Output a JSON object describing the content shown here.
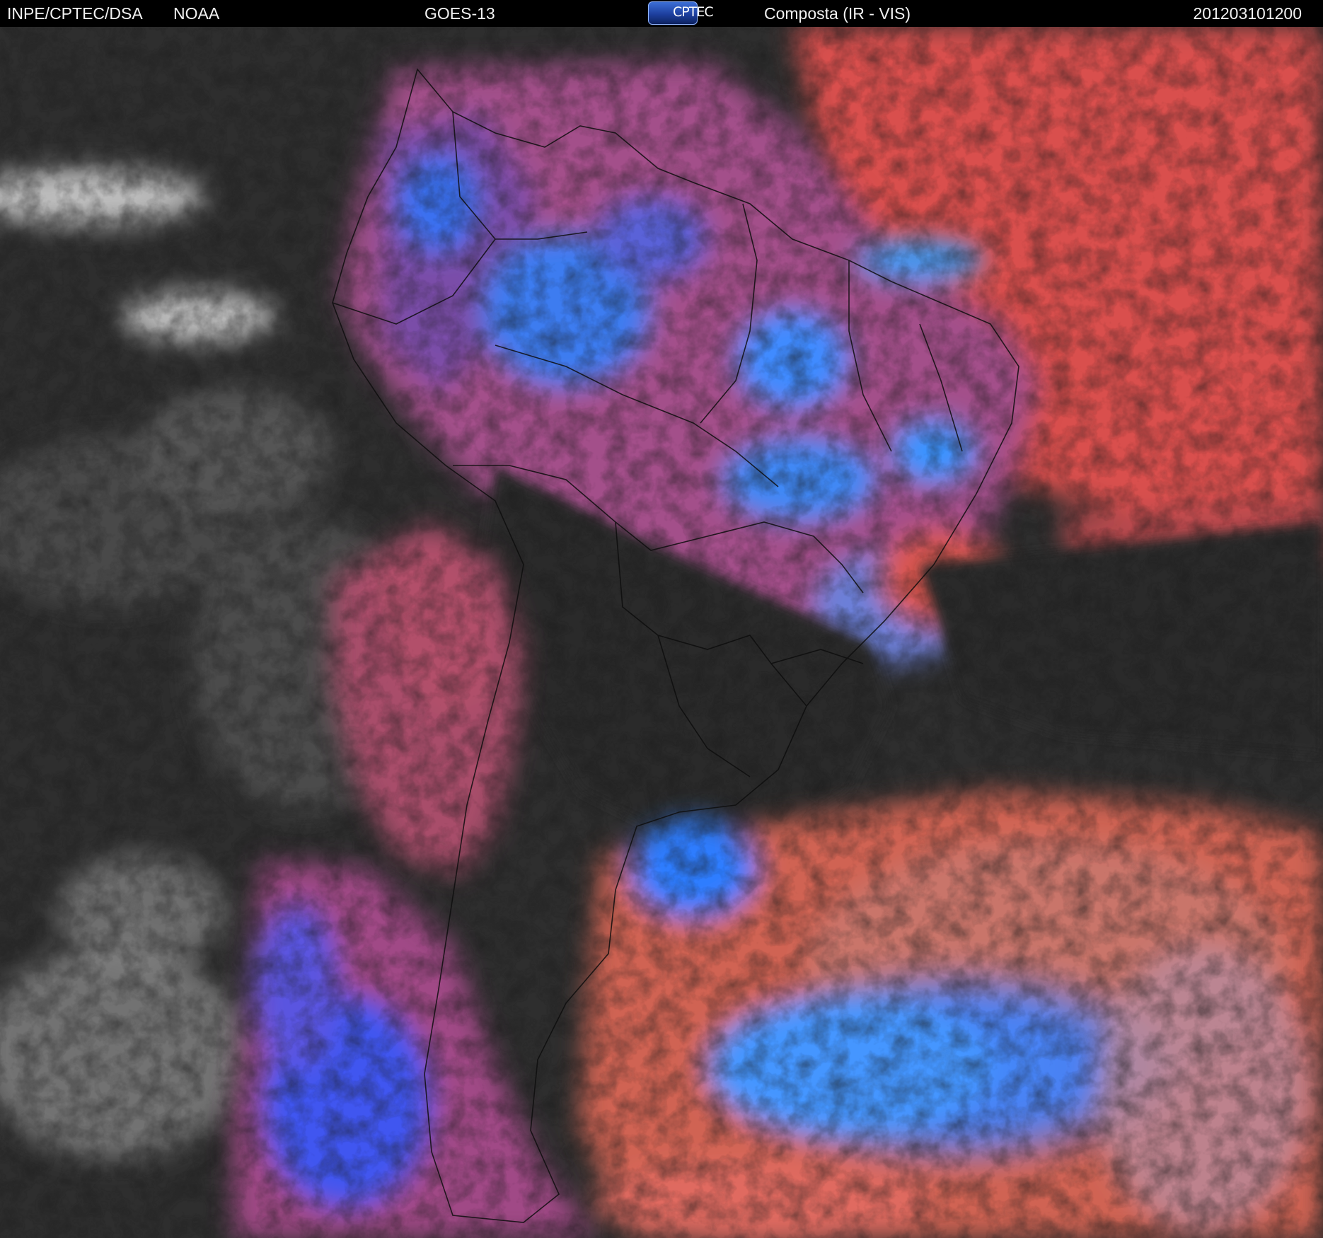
{
  "header": {
    "org": "INPE/CPTEC/DSA",
    "agency": "NOAA",
    "satellite": "GOES-13",
    "logo_text": "CPTEC",
    "product": "Composta (IR - VIS)",
    "timestamp": "201203101200"
  },
  "colors": {
    "header_background": "#000000",
    "header_text": "#f2f2f2",
    "ocean_clear": "#2e2e2e",
    "high_cloud_blue": "#2f7dff",
    "low_cloud_red": "#d9514e",
    "mixed_magenta": "#a04a86",
    "grey_cloud": "#d9d9d9"
  }
}
